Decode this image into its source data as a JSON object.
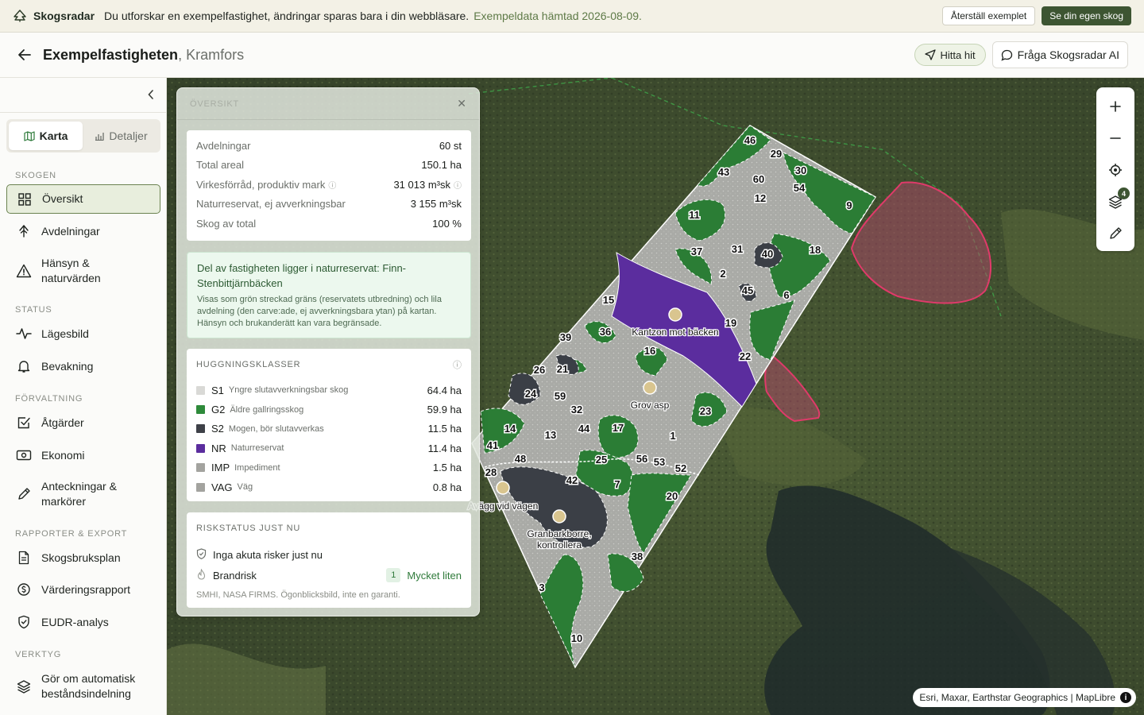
{
  "banner": {
    "brand": "Skogsradar",
    "message": "Du utforskar en exempelfastighet, ändringar sparas bara i din webbläsare.",
    "fetched": "Exempeldata hämtad 2026-08-09.",
    "reset_label": "Återställ exemplet",
    "own_label": "Se din egen skog"
  },
  "header": {
    "title": "Exempelfastigheten",
    "location": ", Kramfors",
    "goto_label": "Hitta hit",
    "ai_label": "Fråga Skogsradar AI"
  },
  "sidebar": {
    "tabs": {
      "map": "Karta",
      "details": "Detaljer"
    },
    "sections": {
      "forest": "SKOGEN",
      "status": "STATUS",
      "management": "FÖRVALTNING",
      "reports": "RAPPORTER & EXPORT",
      "tools": "VERKTYG"
    },
    "items": {
      "overview": "Översikt",
      "stands": "Avdelningar",
      "considerations": "Hänsyn & naturvärden",
      "situation": "Lägesbild",
      "monitoring": "Bevakning",
      "actions": "Åtgärder",
      "economy": "Ekonomi",
      "notes": "Anteckningar & markörer",
      "plan": "Skogsbruksplan",
      "valuation": "Värderingsrapport",
      "eudr": "EUDR-analys",
      "auto_division": "Gör om automatisk beståndsindelning"
    }
  },
  "panel": {
    "title": "ÖVERSIKT",
    "stats": [
      {
        "label": "Avdelningar",
        "value": "60 st"
      },
      {
        "label": "Total areal",
        "value": "150.1 ha"
      },
      {
        "label": "Virkesförråd, produktiv mark",
        "value": "31 013 m³sk"
      },
      {
        "label": "Naturreservat, ej avverkningsbar",
        "value": "3 155 m³sk"
      },
      {
        "label": "Skog av total",
        "value": "100 %"
      }
    ],
    "reserve": {
      "title": "Del av fastigheten ligger i naturreservat: Finn-Stenbittjärnbäcken",
      "description": "Visas som grön streckad gräns (reservatets utbredning) och lila avdelning (den carve:ade, ej avverkningsbara ytan) på kartan. Hänsyn och brukanderätt kan vara begränsade."
    },
    "classes_title": "HUGGNINGSKLASSER",
    "classes": [
      {
        "code": "S1",
        "desc": "Yngre slutavverkningsbar skog",
        "area": "64.4 ha",
        "color": "#d9d9d6"
      },
      {
        "code": "G2",
        "desc": "Äldre gallringsskog",
        "area": "59.9 ha",
        "color": "#2e8a3a"
      },
      {
        "code": "S2",
        "desc": "Mogen, bör slutavverkas",
        "area": "11.5 ha",
        "color": "#3e4148"
      },
      {
        "code": "NR",
        "desc": "Naturreservat",
        "area": "11.4 ha",
        "color": "#5b2d9e"
      },
      {
        "code": "IMP",
        "desc": "Impediment",
        "area": "1.5 ha",
        "color": "#a3a39f"
      },
      {
        "code": "VAG",
        "desc": "Väg",
        "area": "0.8 ha",
        "color": "#a3a39f"
      }
    ],
    "risk_title": "RISKSTATUS JUST NU",
    "risk_none": "Inga akuta risker just nu",
    "fire_label": "Brandrisk",
    "fire_level": "1",
    "fire_text": "Mycket liten",
    "risk_source": "SMHI, NASA FIRMS. Ögonblicksbild, inte en garanti."
  },
  "map": {
    "attribution": "Esri, Maxar, Earthstar Geographics",
    "maplibre": "MapLibre",
    "layers_count": "4",
    "labels": {
      "kantzon": "Kantzon mot bäcken",
      "grov_asp": "Grov asp",
      "avagg": "Avägg vid vägen",
      "granbarkborre_1": "Granbarkborre,",
      "granbarkborre_2": "kontrollera"
    },
    "stand_numbers": [
      "46",
      "29",
      "43",
      "60",
      "30",
      "54",
      "12",
      "9",
      "11",
      "37",
      "31",
      "40",
      "18",
      "2",
      "45",
      "6",
      "15",
      "19",
      "36",
      "16",
      "22",
      "39",
      "26",
      "21",
      "24",
      "59",
      "23",
      "32",
      "44",
      "17",
      "1",
      "14",
      "13",
      "41",
      "48",
      "25",
      "56",
      "53",
      "28",
      "42",
      "7",
      "52",
      "20",
      "38",
      "3",
      "10"
    ]
  }
}
